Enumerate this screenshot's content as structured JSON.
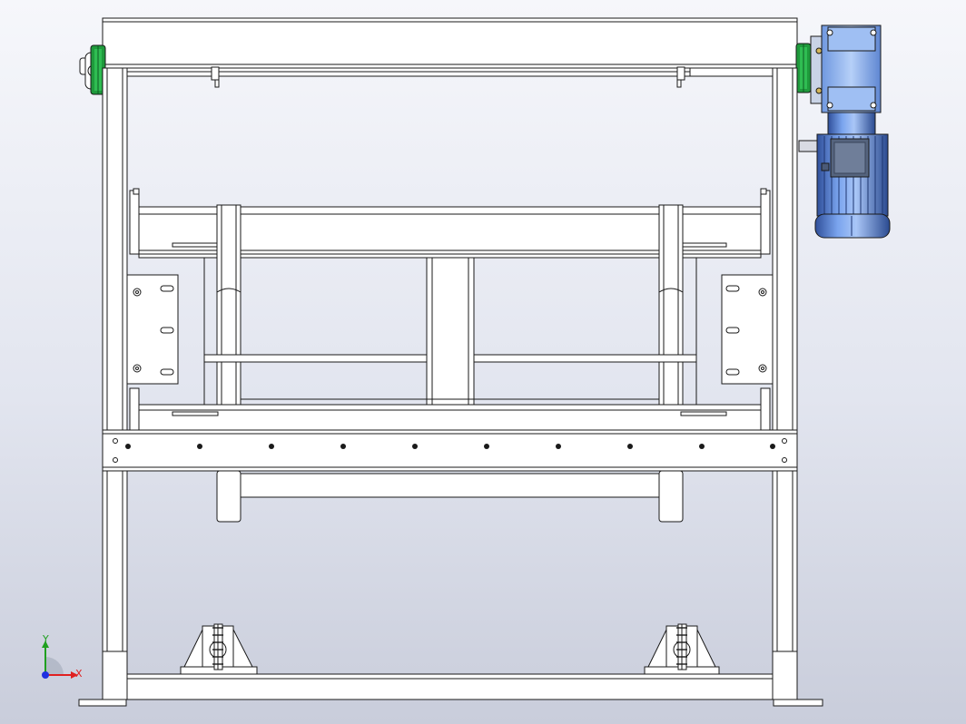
{
  "viewport": {
    "background_top": "#f6f7fb",
    "background_bottom": "#c9cddb"
  },
  "model": {
    "view": "front",
    "line_color": "#1a1a1a",
    "part_fill": "#ffffff",
    "bearing_color": "#1f9a3c",
    "motor_color": "#5d8be0",
    "motor_dark": "#2f4f9a",
    "gearbox_color": "#8fb6ee"
  },
  "triad": {
    "x_label": "X",
    "y_label": "Y",
    "x_color": "#e02020",
    "y_color": "#20a020",
    "z_color": "#2030e0"
  }
}
